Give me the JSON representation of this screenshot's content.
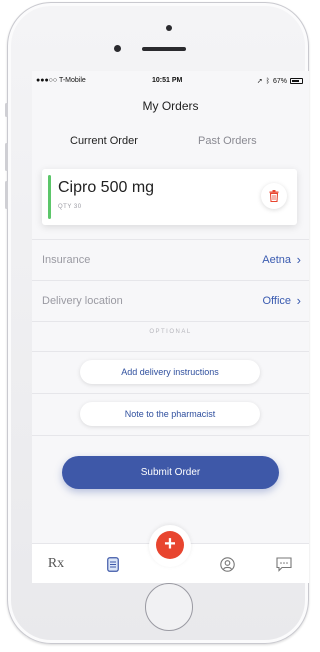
{
  "status_bar": {
    "carrier": "●●●○○ T-Mobile",
    "time": "10:51 PM",
    "battery": "67%"
  },
  "header": {
    "title": "My Orders"
  },
  "tabs": [
    {
      "label": "Current Order",
      "active": true
    },
    {
      "label": "Past Orders",
      "active": false
    }
  ],
  "order": {
    "medication": "Cipro 500 mg",
    "qty": "QTY 30",
    "accent_color": "#5cc66a",
    "delete_icon": "trash-icon"
  },
  "details": [
    {
      "label": "Insurance",
      "value": "Aetna"
    },
    {
      "label": "Delivery location",
      "value": "Office"
    }
  ],
  "optional_label": "OPTIONAL",
  "actions": {
    "delivery_instructions": "Add delivery instructions",
    "pharmacist_note": "Note to the pharmacist",
    "submit": "Submit Order"
  },
  "tabbar": {
    "items": [
      "rx-icon",
      "document-icon",
      "add-icon",
      "profile-icon",
      "chat-icon"
    ],
    "rx_label": "Rx",
    "fab_color": "#e8452f"
  },
  "colors": {
    "primary": "#3e58a8",
    "link": "#3a5bb0",
    "danger": "#e8452f"
  }
}
